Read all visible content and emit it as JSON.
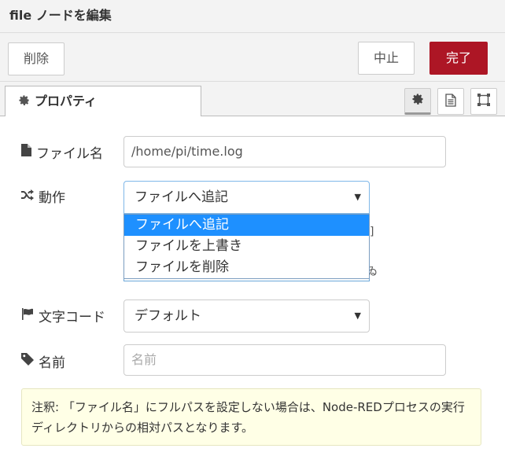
{
  "window": {
    "title": "file ノードを編集"
  },
  "toolbar": {
    "delete_label": "削除",
    "cancel_label": "中止",
    "done_label": "完了"
  },
  "tabs": {
    "properties_label": "プロパティ"
  },
  "form": {
    "filename": {
      "label": "ファイル名",
      "value": "/home/pi/time.log"
    },
    "action": {
      "label": "動作",
      "selected": "ファイルへ追記",
      "options": [
        "ファイルへ追記",
        "ファイルを上書き",
        "ファイルを削除"
      ]
    },
    "hidden_fragments": {
      "right_bracket": "]",
      "partial_char": "ゐ"
    },
    "encoding": {
      "label": "文字コード",
      "selected": "デフォルト"
    },
    "name": {
      "label": "名前",
      "placeholder": "名前"
    }
  },
  "tip": {
    "text": "注釈: 「ファイル名」にフルパスを設定しない場合は、Node-REDプロセスの実行ディレクトリからの相対パスとなります。"
  },
  "colors": {
    "done_button": "#ad1625",
    "dropdown_highlight": "#1e90ff",
    "tip_background": "#ffffe6"
  }
}
